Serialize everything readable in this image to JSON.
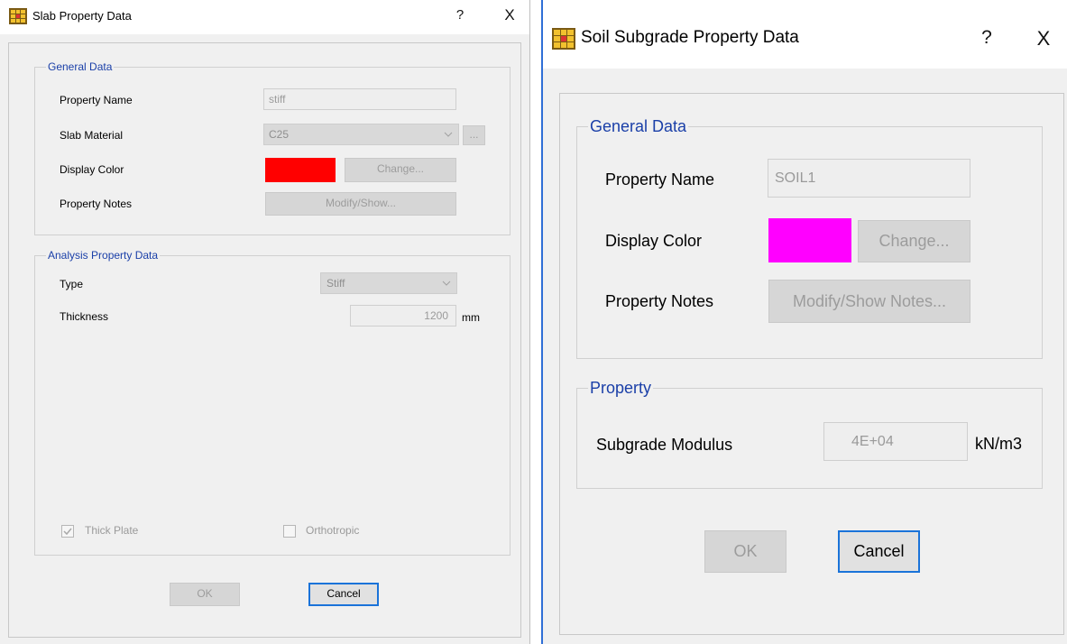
{
  "slab": {
    "title": "Slab Property Data",
    "help": "?",
    "close": "X",
    "general_group": "General Data",
    "property_name_label": "Property Name",
    "property_name_value": "stiff",
    "slab_material_label": "Slab Material",
    "slab_material_value": "C25",
    "ellipsis": "...",
    "display_color_label": "Display Color",
    "display_color": "#ff0000",
    "change_label": "Change...",
    "property_notes_label": "Property Notes",
    "modify_label": "Modify/Show...",
    "analysis_group": "Analysis Property Data",
    "type_label": "Type",
    "type_value": "Stiff",
    "thickness_label": "Thickness",
    "thickness_value": "1200",
    "thickness_unit": "mm",
    "thick_plate_label": "Thick Plate",
    "thick_plate_checked": true,
    "orthotropic_label": "Orthotropic",
    "orthotropic_checked": false,
    "ok_label": "OK",
    "cancel_label": "Cancel"
  },
  "soil": {
    "title": "Soil Subgrade Property Data",
    "help": "?",
    "close": "X",
    "general_group": "General Data",
    "property_name_label": "Property Name",
    "property_name_value": "SOIL1",
    "display_color_label": "Display Color",
    "display_color": "#ff00ff",
    "change_label": "Change...",
    "property_notes_label": "Property Notes",
    "modify_label": "Modify/Show Notes...",
    "property_group": "Property",
    "subgrade_label": "Subgrade Modulus",
    "subgrade_value": "4E+04",
    "subgrade_unit": "kN/m3",
    "ok_label": "OK",
    "cancel_label": "Cancel"
  },
  "colors": {
    "accent": "#1a73d9",
    "group_legend": "#1a3fa8",
    "dialog_bg": "#f0f0f0"
  }
}
